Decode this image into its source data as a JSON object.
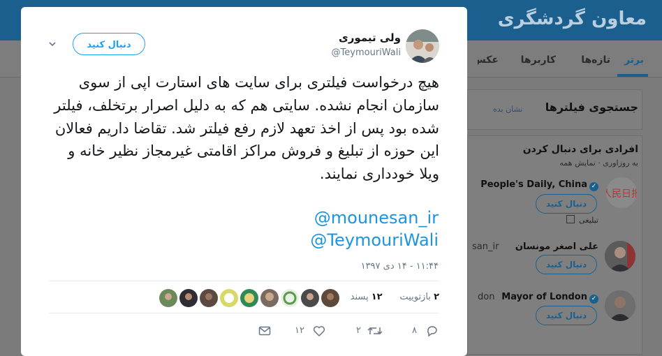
{
  "background": {
    "site_title": "معاون گردشگری",
    "tabs": [
      {
        "label": "برتر",
        "active": true
      },
      {
        "label": "تازه‌ها",
        "active": false
      },
      {
        "label": "کاربرها",
        "active": false
      },
      {
        "label": "عکس‌ها",
        "active": false
      }
    ],
    "search_filters": {
      "title": "جستجوی فیلترها",
      "hide_link": "نشان بده"
    },
    "who_to_follow": {
      "title": "افرادی برای دنبال کردن",
      "sub": "به روزاوری · نمایش همه",
      "people": [
        {
          "name": "People's Daily, China",
          "verified": true,
          "follow": "دنبال کنید",
          "promoted": "تبلیغی"
        },
        {
          "name": "علی اصغر مونسان",
          "handle": "san_ir",
          "follow": "دنبال کنید"
        },
        {
          "name": "Mayor of London",
          "verified": true,
          "handle": "don",
          "follow": "دنبال کنید"
        }
      ]
    }
  },
  "tweet": {
    "author_name": "ولی تیموری",
    "author_handle": "@TeymouriWali",
    "follow_label": "دنبال کنید",
    "caret_icon": "chevron-down-icon",
    "text": "هیچ درخواست فیلتری برای سایت های استارت اپی از سوی سازمان انجام نشده. سایتی هم که به دلیل اصرار برتخلف، فیلتر شده بود پس از اخذ تعهد لازم رفع فیلتر شد. تقاضا داریم فعالان این حوزه از تبلیغ و فروش مراکز اقامتی غیرمجاز نظیر خانه و ویلا خودداری نمایند.",
    "mentions": [
      "@mounesan_ir",
      "@TeymouriWali"
    ],
    "timestamp": "۱۱:۴۴ - ۱۴ دی ۱۳۹۷",
    "retweets": {
      "count": "۲",
      "label": "بازتوییت"
    },
    "likes": {
      "count": "۱۲",
      "label": "پسند"
    },
    "actions": {
      "reply": {
        "icon": "reply-icon",
        "count": "۸"
      },
      "retweet": {
        "icon": "retweet-icon",
        "count": "۲"
      },
      "like": {
        "icon": "heart-icon",
        "count": "۱۲"
      },
      "dm": {
        "icon": "envelope-icon"
      }
    },
    "colors": {
      "accent": "#1da1f2",
      "mention": "#1b95e0",
      "text": "#14171a",
      "muted": "#657786"
    }
  }
}
